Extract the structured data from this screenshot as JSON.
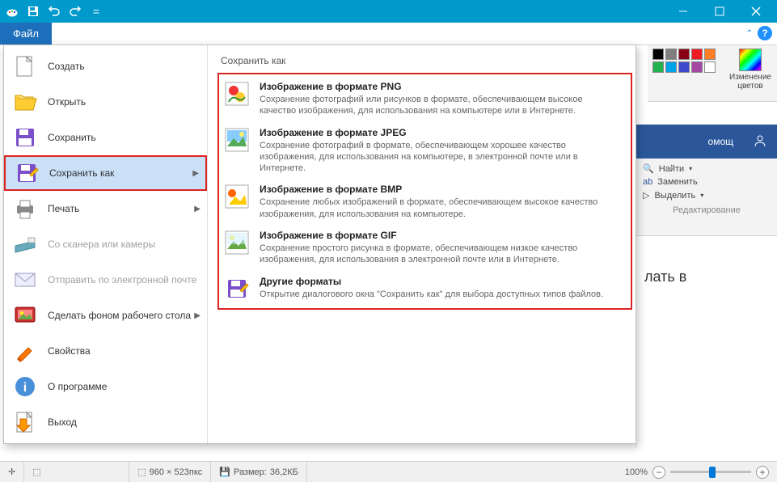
{
  "window": {
    "file_tab": "Файл"
  },
  "menu": {
    "items": [
      {
        "label": "Создать",
        "icon": "new"
      },
      {
        "label": "Открыть",
        "icon": "open"
      },
      {
        "label": "Сохранить",
        "icon": "save"
      },
      {
        "label": "Сохранить как",
        "icon": "saveas",
        "highlighted": true,
        "submenu": true
      },
      {
        "label": "Печать",
        "icon": "print",
        "submenu": true
      },
      {
        "label": "Со сканера или камеры",
        "icon": "scanner",
        "disabled": true
      },
      {
        "label": "Отправить по электронной почте",
        "icon": "email",
        "disabled": true
      },
      {
        "label": "Сделать фоном рабочего стола",
        "icon": "wallpaper",
        "submenu": true
      },
      {
        "label": "Свойства",
        "icon": "properties"
      },
      {
        "label": "О программе",
        "icon": "about"
      },
      {
        "label": "Выход",
        "icon": "exit"
      }
    ]
  },
  "saveas_panel": {
    "title": "Сохранить как",
    "formats": [
      {
        "title": "Изображение в формате PNG",
        "desc": "Сохранение фотографий или рисунков в формате, обеспечивающем высокое качество изображения, для использования на компьютере или в Интернете.",
        "icon": "png"
      },
      {
        "title": "Изображение в формате JPEG",
        "desc": "Сохранение фотографий в формате, обеспечивающем хорошее качество изображения, для использования на компьютере, в электронной почте или в Интернете.",
        "icon": "jpeg"
      },
      {
        "title": "Изображение в формате BMP",
        "desc": "Сохранение любых изображений в формате, обеспечивающем высокое качество изображения, для использования на компьютере.",
        "icon": "bmp"
      },
      {
        "title": "Изображение в формате GIF",
        "desc": "Сохранение простого рисунка в формате, обеспечивающем низкое качество изображения, для использования в электронной почте или в Интернете.",
        "icon": "gif"
      },
      {
        "title": "Другие форматы",
        "desc": "Открытие диалогового окна \"Сохранить как\" для выбора доступных типов файлов.",
        "icon": "other"
      }
    ]
  },
  "ribbon_bg": {
    "edit_colors": "Изменение\nцветов",
    "colors": [
      "#000",
      "#7f7f7f",
      "#800",
      "#f00",
      "#f80",
      "#ff0",
      "#0c0",
      "#0cc",
      "#3a6ea5",
      "#1e3a8a",
      "#80f",
      "#f0f"
    ]
  },
  "word": {
    "tab": "омощ",
    "find": "Найти",
    "replace": "Заменить",
    "select": "Выделить",
    "group": "Редактирование",
    "doc_fragment": "лать в"
  },
  "statusbar": {
    "dims": "960 × 523пкс",
    "size_label": "Размер:",
    "size": "36,2КБ",
    "zoom": "100%"
  }
}
